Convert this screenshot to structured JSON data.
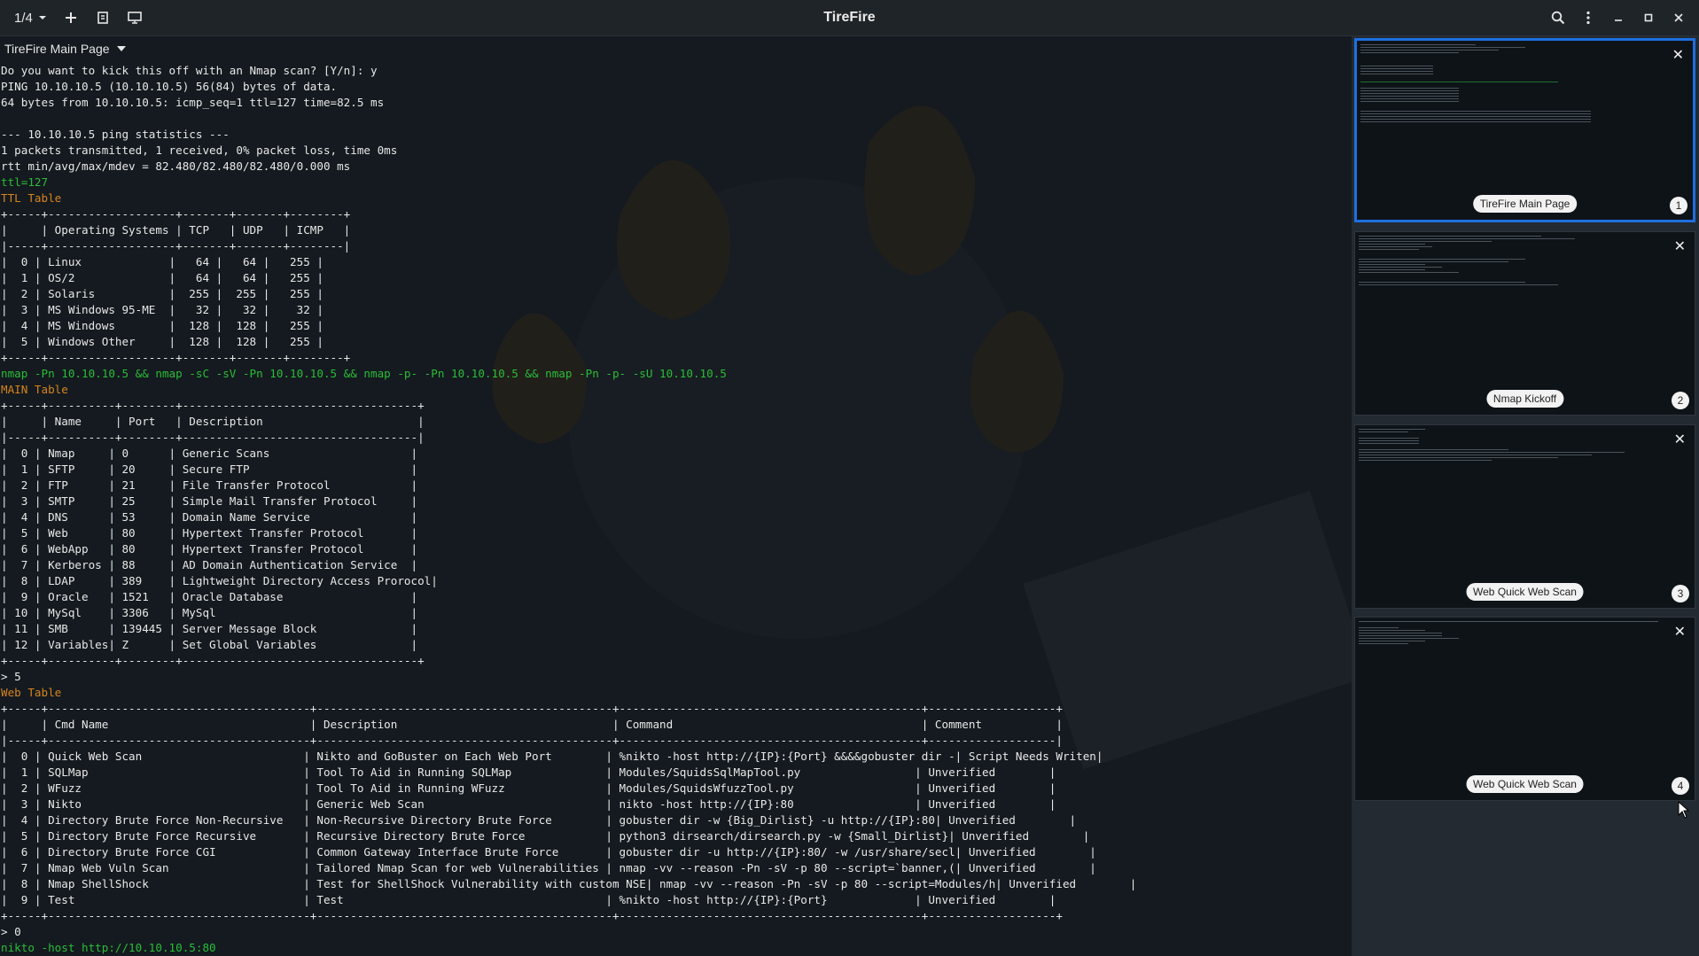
{
  "app": {
    "title": "TireFire",
    "tab_counter": "1/4"
  },
  "header_icons": {
    "counter_dropdown": "chevron-down-icon",
    "new_tab": "plus-icon",
    "detach": "detach-icon",
    "screen": "screen-icon",
    "search": "search-icon",
    "menu": "kebab-menu-icon",
    "minimize": "minimize-icon",
    "maximize": "maximize-icon",
    "close": "close-icon"
  },
  "terminal": {
    "tab_label": "TireFire Main Page",
    "intro_lines": [
      "Do you want to kick this off with an Nmap scan? [Y/n]: y",
      "PING 10.10.10.5 (10.10.10.5) 56(84) bytes of data.",
      "64 bytes from 10.10.10.5: icmp_seq=1 ttl=127 time=82.5 ms",
      "",
      "--- 10.10.10.5 ping statistics ---",
      "1 packets transmitted, 1 received, 0% packet loss, time 0ms",
      "rtt min/avg/max/mdev = 82.480/82.480/82.480/0.000 ms"
    ],
    "ttl_line": "ttl=127",
    "ttl_table_title": "TTL Table",
    "ttl_table": {
      "headers": [
        "",
        "Operating Systems",
        "TCP",
        "UDP",
        "ICMP"
      ],
      "rows": [
        [
          "0",
          "Linux",
          "64",
          "64",
          "255"
        ],
        [
          "1",
          "OS/2",
          "64",
          "64",
          "255"
        ],
        [
          "2",
          "Solaris",
          "255",
          "255",
          "255"
        ],
        [
          "3",
          "MS Windows 95-ME",
          "32",
          "32",
          "32"
        ],
        [
          "4",
          "MS Windows",
          "128",
          "128",
          "255"
        ],
        [
          "5",
          "Windows Other",
          "128",
          "128",
          "255"
        ]
      ]
    },
    "nmap_command": "nmap -Pn 10.10.10.5 && nmap -sC -sV -Pn 10.10.10.5 && nmap -p- -Pn 10.10.10.5 && nmap -Pn -p- -sU 10.10.10.5",
    "main_table_title": "MAIN Table",
    "main_table": {
      "headers": [
        "",
        "Name",
        "Port",
        "Description"
      ],
      "rows": [
        [
          "0",
          "Nmap",
          "0",
          "Generic Scans"
        ],
        [
          "1",
          "SFTP",
          "20",
          "Secure FTP"
        ],
        [
          "2",
          "FTP",
          "21",
          "File Transfer Protocol"
        ],
        [
          "3",
          "SMTP",
          "25",
          "Simple Mail Transfer Protocol"
        ],
        [
          "4",
          "DNS",
          "53",
          "Domain Name Service"
        ],
        [
          "5",
          "Web",
          "80",
          "Hypertext Transfer Protocol"
        ],
        [
          "6",
          "WebApp",
          "80",
          "Hypertext Transfer Protocol"
        ],
        [
          "7",
          "Kerberos",
          "88",
          "AD Domain Authentication Service"
        ],
        [
          "8",
          "LDAP",
          "389",
          "Lightweight Directory Access Prorocol"
        ],
        [
          "9",
          "Oracle",
          "1521",
          "Oracle Database"
        ],
        [
          "10",
          "MySql",
          "3306",
          "MySql"
        ],
        [
          "11",
          "SMB",
          "139445",
          "Server Message Block"
        ],
        [
          "12",
          "Variables",
          "Z",
          "Set Global Variables"
        ]
      ]
    },
    "prompt_1": "> 5",
    "web_table_title": "Web Table",
    "web_table": {
      "headers": [
        "",
        "Cmd Name",
        "Description",
        "Command",
        "Comment"
      ],
      "rows": [
        [
          "0",
          "Quick Web Scan",
          "Nikto and GoBuster on Each Web Port",
          "%nikto -host http://{IP}:{Port} &&&&gobuster dir -",
          "Script Needs Writen"
        ],
        [
          "1",
          "SQLMap",
          "Tool To Aid in Running SQLMap",
          "Modules/SquidsSqlMapTool.py",
          "Unverified"
        ],
        [
          "2",
          "WFuzz",
          "Tool To Aid in Running WFuzz",
          "Modules/SquidsWfuzzTool.py",
          "Unverified"
        ],
        [
          "3",
          "Nikto",
          "Generic Web Scan",
          "nikto -host http://{IP}:80",
          "Unverified"
        ],
        [
          "4",
          "Directory Brute Force Non-Recursive",
          "Non-Recursive Directory Brute Force",
          "gobuster dir -w {Big_Dirlist} -u http://{IP}:80",
          "Unverified"
        ],
        [
          "5",
          "Directory Brute Force Recursive",
          "Recursive Directory Brute Force",
          "python3 dirsearch/dirsearch.py -w {Small_Dirlist}",
          "Unverified"
        ],
        [
          "6",
          "Directory Brute Force CGI",
          "Common Gateway Interface Brute Force",
          "gobuster dir -u http://{IP}:80/ -w /usr/share/secl",
          "Unverified"
        ],
        [
          "7",
          "Nmap Web Vuln Scan",
          "Tailored Nmap Scan for web Vulnerabilities",
          "nmap -vv --reason -Pn -sV -p 80 --script=`banner,(",
          "Unverified"
        ],
        [
          "8",
          "Nmap ShellShock",
          "Test for ShellShock Vulnerability with custom NSE",
          "nmap -vv --reason -Pn -sV -p 80 --script=Modules/h",
          "Unverified"
        ],
        [
          "9",
          "Test",
          "Test",
          "%nikto -host http://{IP}:{Port}",
          "Unverified"
        ]
      ]
    },
    "prompt_2": "> 0",
    "final_command": "nikto -host http://10.10.10.5:80"
  },
  "sidebar": {
    "thumbnails": [
      {
        "label": "TireFire Main Page",
        "number": "1",
        "active": true
      },
      {
        "label": "Nmap Kickoff",
        "number": "2",
        "active": false
      },
      {
        "label": "Web Quick Web Scan",
        "number": "3",
        "active": false
      },
      {
        "label": "Web Quick Web Scan",
        "number": "4",
        "active": false
      }
    ]
  },
  "colors": {
    "accent": "#1e6fe0",
    "green_text": "#2bbd39",
    "orange_text": "#d7841e"
  }
}
